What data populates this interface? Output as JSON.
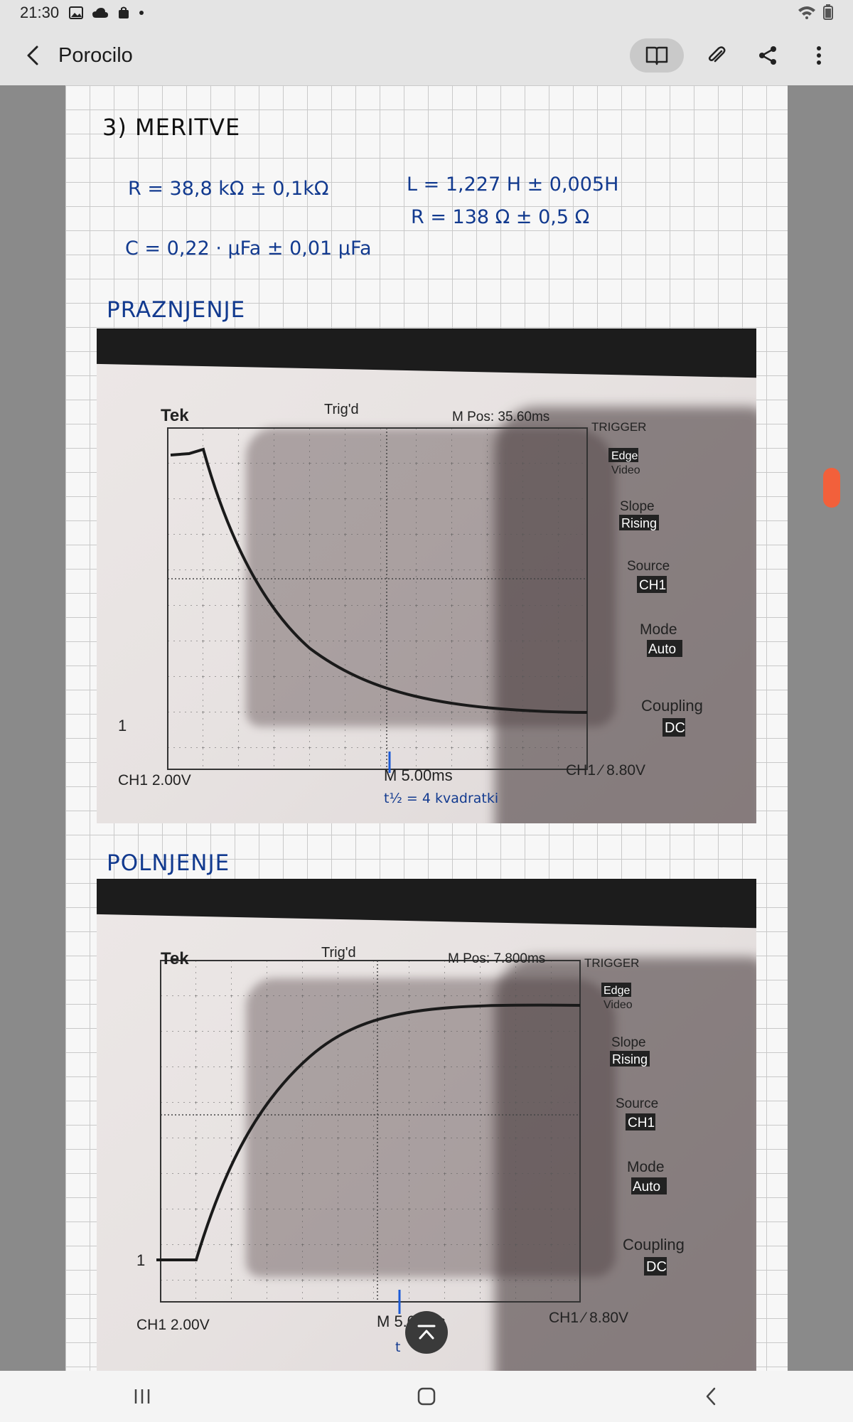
{
  "status": {
    "time": "21:30"
  },
  "app": {
    "title": "Porocilo"
  },
  "note": {
    "heading": "3) MERITVE",
    "eq_r": "R = 38,8 kΩ ± 0,1kΩ",
    "eq_c": "C = 0,22 · μFa ± 0,01 μFa",
    "eq_l": "L = 1,227 H ± 0,005H",
    "eq_rl": "R = 138 Ω ± 0,5 Ω",
    "section1": "PRAZNJENJE",
    "section2": "POLNJENJE",
    "annotation1": "t½ = 4 kvadratki",
    "annotation2": "t"
  },
  "scope1": {
    "brand": "Tek",
    "trig": "Trig'd",
    "mpos": "M Pos: 35.60ms",
    "trigger_title": "TRIGGER",
    "edge": "Edge",
    "video": "Video",
    "slope": "Slope",
    "rising": "Rising",
    "source": "Source",
    "ch1": "CH1",
    "mode": "Mode",
    "auto": "Auto",
    "coupling": "Coupling",
    "dc": "DC",
    "ch1_scale": "CH1  2.00V",
    "timebase": "M 5.00ms",
    "trig_level": "CH1 ⁄ 8.80V",
    "marker": "1"
  },
  "scope2": {
    "brand": "Tek",
    "trig": "Trig'd",
    "mpos": "M Pos: 7.800ms",
    "trigger_title": "TRIGGER",
    "edge": "Edge",
    "video": "Video",
    "slope": "Slope",
    "rising": "Rising",
    "source": "Source",
    "ch1": "CH1",
    "mode": "Mode",
    "auto": "Auto",
    "coupling": "Coupling",
    "dc": "DC",
    "ch1_scale": "CH1  2.00V",
    "timebase": "M 5.00ms",
    "trig_level": "CH1 ⁄ 8.80V",
    "marker": "1"
  }
}
